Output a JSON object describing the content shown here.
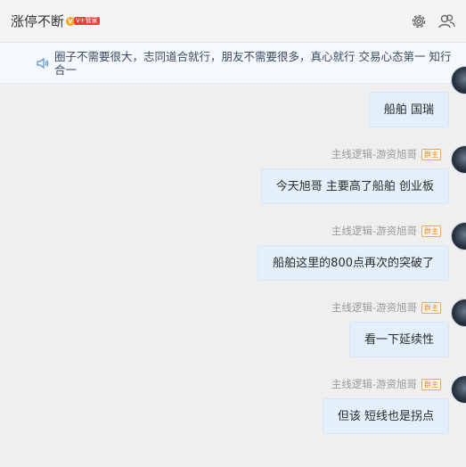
{
  "header": {
    "title": "涨停不断",
    "badge": "V",
    "badge_label": "V+管家"
  },
  "notice": {
    "text": "圈子不需要很大，志同道合就行，朋友不需要很多，真心就行 交易心态第一 知行合一"
  },
  "messages": [
    {
      "sender": "",
      "role": "",
      "text": "船舶 国瑞"
    },
    {
      "sender": "主线逻辑-游资旭哥",
      "role": "群主",
      "text": "今天旭哥 主要高了船舶  创业板"
    },
    {
      "sender": "主线逻辑-游资旭哥",
      "role": "群主",
      "text": "船舶这里的800点再次的突破了"
    },
    {
      "sender": "主线逻辑-游资旭哥",
      "role": "群主",
      "text": "看一下延续性"
    },
    {
      "sender": "主线逻辑-游资旭哥",
      "role": "群主",
      "text": "但该 短线也是拐点"
    }
  ]
}
